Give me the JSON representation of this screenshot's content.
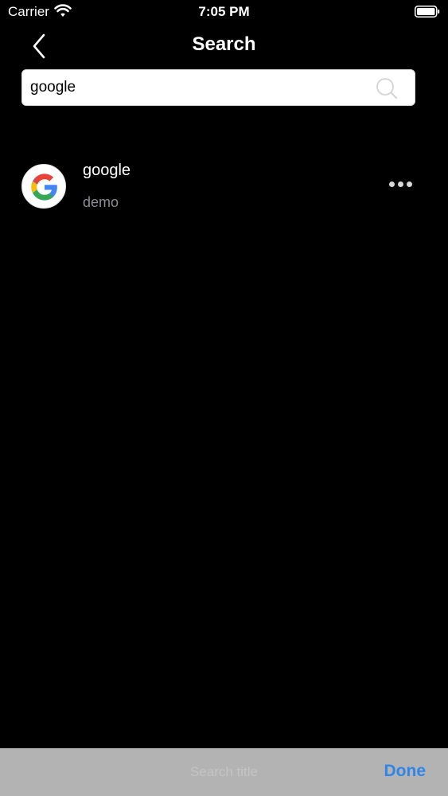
{
  "status_bar": {
    "carrier": "Carrier",
    "time": "7:05 PM"
  },
  "nav": {
    "title": "Search",
    "back_icon": "chevron-left-icon"
  },
  "search": {
    "value": "google",
    "placeholder": "",
    "icon": "search-icon"
  },
  "results": [
    {
      "title": "google",
      "subtitle": "demo",
      "icon": "google-logo-icon"
    }
  ],
  "toolbar": {
    "placeholder": "Search title",
    "done_label": "Done"
  },
  "colors": {
    "background": "#000000",
    "accent": "#2f86e8",
    "toolbar": "#b3b3b3",
    "secondary_text": "#8e8e93"
  }
}
